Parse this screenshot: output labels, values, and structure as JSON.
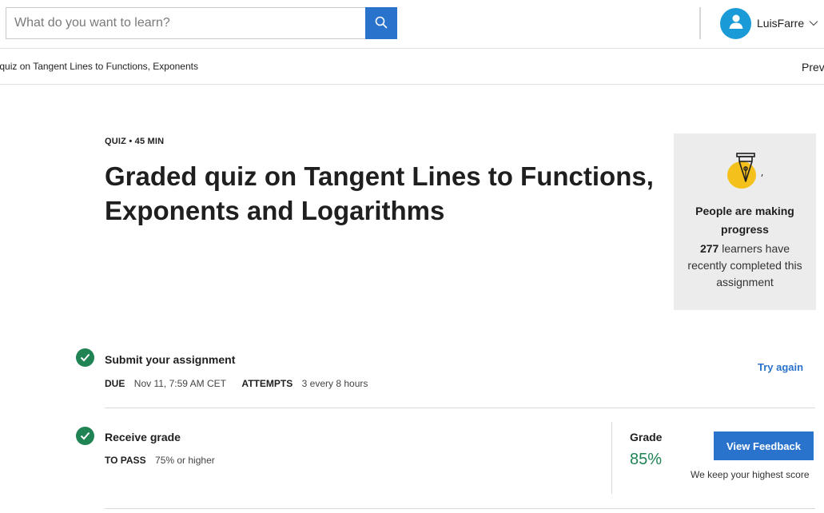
{
  "search": {
    "placeholder": "What do you want to learn?"
  },
  "user": {
    "name": "LuisFarre"
  },
  "breadcrumb": {
    "text": "Graded quiz on Tangent Lines to Functions, Exponents",
    "prev_label": "Previous"
  },
  "item": {
    "meta": "QUIZ • 45 MIN",
    "title": "Graded quiz on Tangent Lines to Functions, Exponents and Logarithms"
  },
  "progress_card": {
    "title": "People are making progress",
    "count": "277",
    "body": "learners have recently completed this assignment"
  },
  "steps": {
    "submit": {
      "title": "Submit your assignment",
      "due_label": "DUE",
      "due_value": "Nov 11, 7:59 AM CET",
      "attempts_label": "ATTEMPTS",
      "attempts_value": "3 every 8 hours",
      "action": "Try again"
    },
    "receive": {
      "title": "Receive grade",
      "pass_label": "TO PASS",
      "pass_value": "75% or higher",
      "grade_label": "Grade",
      "grade_value": "85%",
      "button": "View Feedback",
      "note": "We keep your highest score"
    }
  },
  "colors": {
    "accent": "#2a73cc",
    "success": "#1f8354",
    "avatar": "#1a9bd7",
    "card_bg": "#ececec"
  },
  "icons": [
    "search-icon",
    "user-icon",
    "chevron-down-icon",
    "pen-nib-icon",
    "check-icon"
  ]
}
